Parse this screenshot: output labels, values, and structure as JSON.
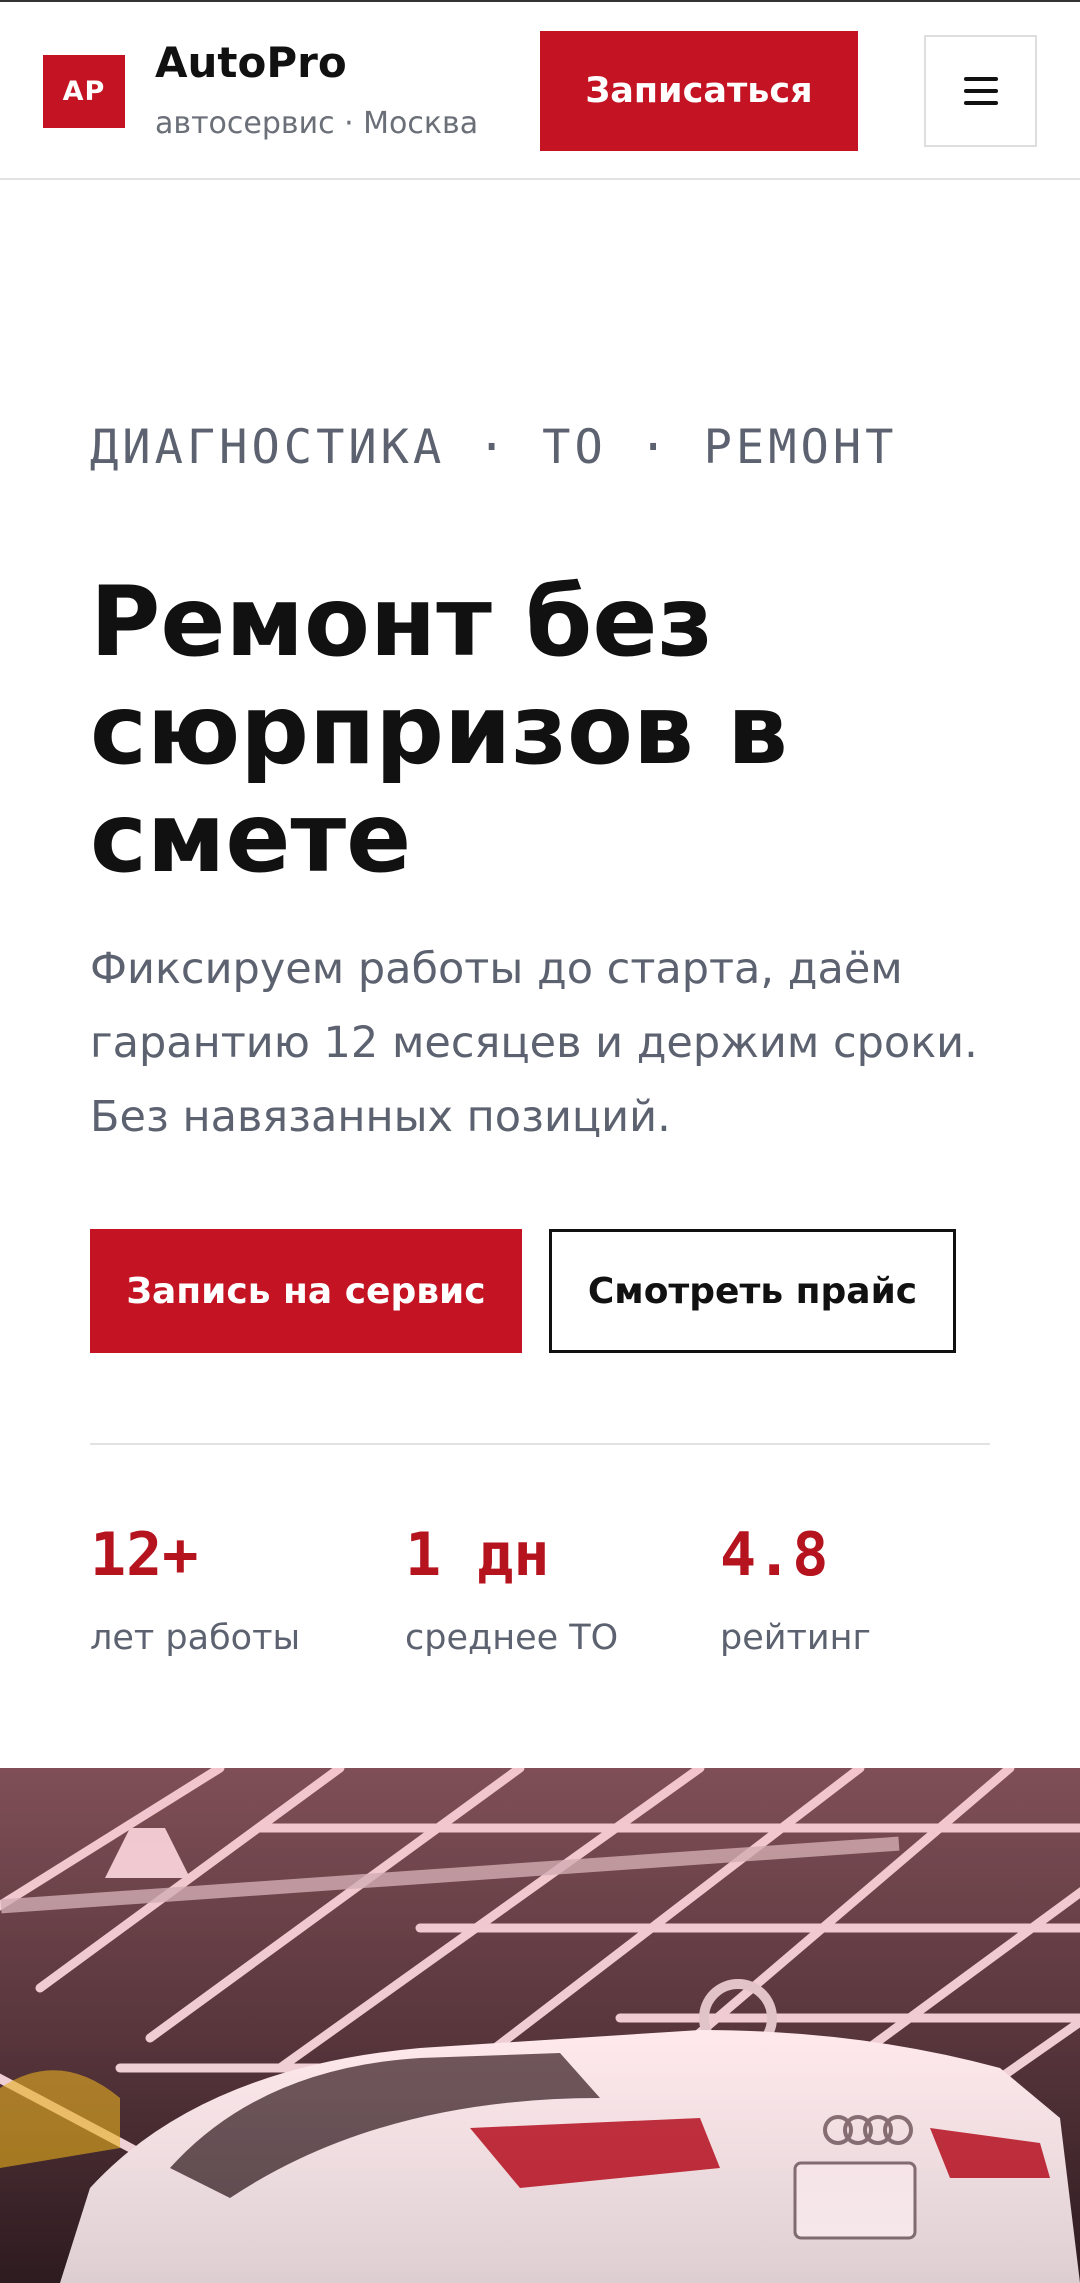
{
  "header": {
    "logo_initials": "AP",
    "brand_name": "AutoPro",
    "brand_subtitle": "автосервис · Москва",
    "cta_label": "Записаться",
    "menu_icon": "hamburger-menu-icon"
  },
  "hero": {
    "eyebrow": "ДИАГНОСТИКА · ТО · РЕМОНТ",
    "title": "Ремонт без сюрпризов в смете",
    "description": "Фиксируем работы до старта, даём гарантию 12 месяцев и держим сроки. Без навязанных позиций.",
    "primary_button": "Запись на сервис",
    "secondary_button": "Смотреть прайс"
  },
  "stats": [
    {
      "value": "12+",
      "label": "лет работы"
    },
    {
      "value": "1 дн",
      "label": "среднее ТО"
    },
    {
      "value": "4.8",
      "label": "рейтинг"
    }
  ],
  "colors": {
    "accent": "#c41424",
    "text": "#111111",
    "muted": "#5d6270"
  }
}
